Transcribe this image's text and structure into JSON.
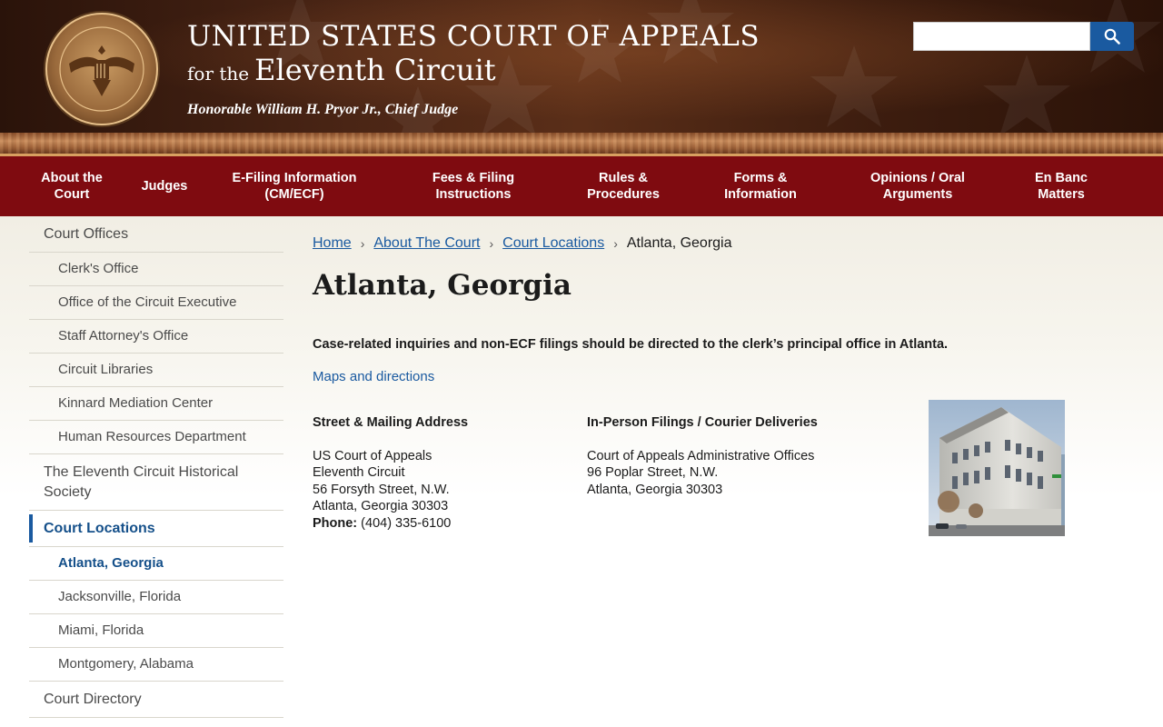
{
  "header": {
    "title_line1": "UNITED STATES COURT OF APPEALS",
    "title_line2_small": "for the",
    "title_line2_big": "Eleventh Circuit",
    "chief_judge": "Honorable William H. Pryor Jr., Chief Judge",
    "seal_text": "UNITED STATES COURT OF APPEALS FOR THE ELEVENTH CIRCUIT",
    "search": {
      "placeholder": "",
      "value": "",
      "button_icon": "search-icon"
    }
  },
  "nav": {
    "items": [
      {
        "label": "About the Court"
      },
      {
        "label": "Judges"
      },
      {
        "label": "E-Filing Information (CM/ECF)"
      },
      {
        "label": "Fees & Filing Instructions"
      },
      {
        "label": "Rules & Procedures"
      },
      {
        "label": "Forms & Information"
      },
      {
        "label": "Opinions / Oral Arguments"
      },
      {
        "label": "En Banc Matters"
      }
    ]
  },
  "sidebar": {
    "items": [
      {
        "label": "Court Offices",
        "level": 1
      },
      {
        "label": "Clerk's Office",
        "level": 2
      },
      {
        "label": "Office of the Circuit Executive",
        "level": 2
      },
      {
        "label": "Staff Attorney's Office",
        "level": 2
      },
      {
        "label": "Circuit Libraries",
        "level": 2
      },
      {
        "label": "Kinnard Mediation Center",
        "level": 2
      },
      {
        "label": "Human Resources Department",
        "level": 2
      },
      {
        "label": "The Eleventh Circuit Historical Society",
        "level": 1
      },
      {
        "label": "Court Locations",
        "level": 1,
        "state": "active-parent"
      },
      {
        "label": "Atlanta, Georgia",
        "level": 2,
        "state": "active"
      },
      {
        "label": "Jacksonville, Florida",
        "level": 2
      },
      {
        "label": "Miami, Florida",
        "level": 2
      },
      {
        "label": "Montgomery, Alabama",
        "level": 2
      },
      {
        "label": "Court Directory",
        "level": 1
      }
    ]
  },
  "breadcrumb": {
    "home": "Home",
    "about": "About The Court",
    "locations": "Court Locations",
    "current": "Atlanta, Georgia"
  },
  "main": {
    "title": "Atlanta, Georgia",
    "intro": "Case-related inquiries and non-ECF filings should be directed to the clerk’s principal office in Atlanta.",
    "maps_link": "Maps and directions",
    "mailing": {
      "heading": "Street & Mailing Address",
      "line1": "US Court of Appeals",
      "line2": "Eleventh Circuit",
      "line3": "56 Forsyth Street, N.W.",
      "line4": "Atlanta, Georgia 30303",
      "phone_label": "Phone:",
      "phone_value": "(404) 335-6100"
    },
    "inperson": {
      "heading": "In-Person Filings / Courier Deliveries",
      "line1": "Court of Appeals Administrative Offices",
      "line2": "96 Poplar Street, N.W.",
      "line3": "Atlanta, Georgia 30303"
    },
    "photo_subject": "courthouse-building"
  },
  "colors": {
    "nav_bg": "#7f0b10",
    "link": "#1a5aa0",
    "accent": "#1a5aa0"
  }
}
